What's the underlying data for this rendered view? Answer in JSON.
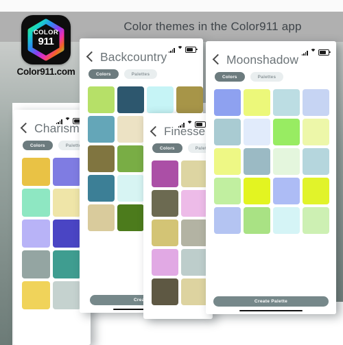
{
  "header": {
    "title": "Color themes in the Color911 app",
    "brand_name": "Color911.com",
    "logo_top_text": "COLOR",
    "logo_bottom_text": "911",
    "logo_icon": "color911-app-icon"
  },
  "status_bar": {
    "signal_icon": "signal-bars-icon",
    "wifi_icon": "wifi-icon",
    "battery_icon": "battery-icon"
  },
  "common": {
    "back_icon": "back-chevron-icon",
    "tab_colors": "Colors",
    "tab_palettes": "Palettes",
    "create_button": "Create Palette",
    "create_button_truncated": "Create",
    "home_indicator": "home-indicator"
  },
  "panels": [
    {
      "id": "charisma",
      "title": "Charisma",
      "active_tab": "Colors",
      "columns": 2,
      "swatches": [
        "#e9c245",
        "#7f7ce2",
        "#8ee7c2",
        "#efe5a8",
        "#b8b3f7",
        "#4a45c4",
        "#94a5a2",
        "#3f9d90",
        "#f0d35a",
        "#c5d2cf"
      ]
    },
    {
      "id": "backcountry",
      "title": "Backcountry",
      "active_tab": "Colors",
      "columns": 4,
      "swatches": [
        "#b6e068",
        "#2d576e",
        "#c6f4f6",
        "#a79548",
        "#64a6b8",
        "#ece2c4",
        "#e2e7d2",
        "#cdd8c4",
        "#807540",
        "#79ad45",
        "#d9e0c8",
        "#bdc9ae",
        "#3c7f96",
        "#d7f4f3",
        "#cfe2d8",
        "#b7cdbd",
        "#d9cb9c",
        "#4c7b1c",
        "#cbd9c0",
        "#a9bf9b"
      ]
    },
    {
      "id": "finesse",
      "title": "Finesse",
      "active_tab": "Colors",
      "columns": 2,
      "swatches": [
        "#ab4fa6",
        "#ddd5a2",
        "#6c6a51",
        "#edbbe8",
        "#d3c475",
        "#b3b3a3",
        "#e1a9e4",
        "#bdcdcb",
        "#5e5843",
        "#ddd3a0"
      ]
    },
    {
      "id": "moonshadow",
      "title": "Moonshadow",
      "active_tab": "Colors",
      "columns": 4,
      "swatches": [
        "#8ea1f0",
        "#ecf87a",
        "#bcdde3",
        "#c6d4f3",
        "#a9cbd2",
        "#e1ebfb",
        "#98ec62",
        "#edf7a9",
        "#eef885",
        "#9bbac4",
        "#e4f6dd",
        "#b5d6dd",
        "#c1efa0",
        "#e3f421",
        "#adbcf5",
        "#e1f32a",
        "#b4c4f2",
        "#a9e284",
        "#d5f4f6",
        "#cdf0b3"
      ]
    }
  ],
  "colors": {
    "accent_pill": "#6c7b7e",
    "pill_inactive_bg": "#e9eeef",
    "title_gray": "#6c7478",
    "create_button_bg": "#76888a",
    "page_title_color": "#3e4449",
    "band_gray": "#b0b0b0"
  }
}
